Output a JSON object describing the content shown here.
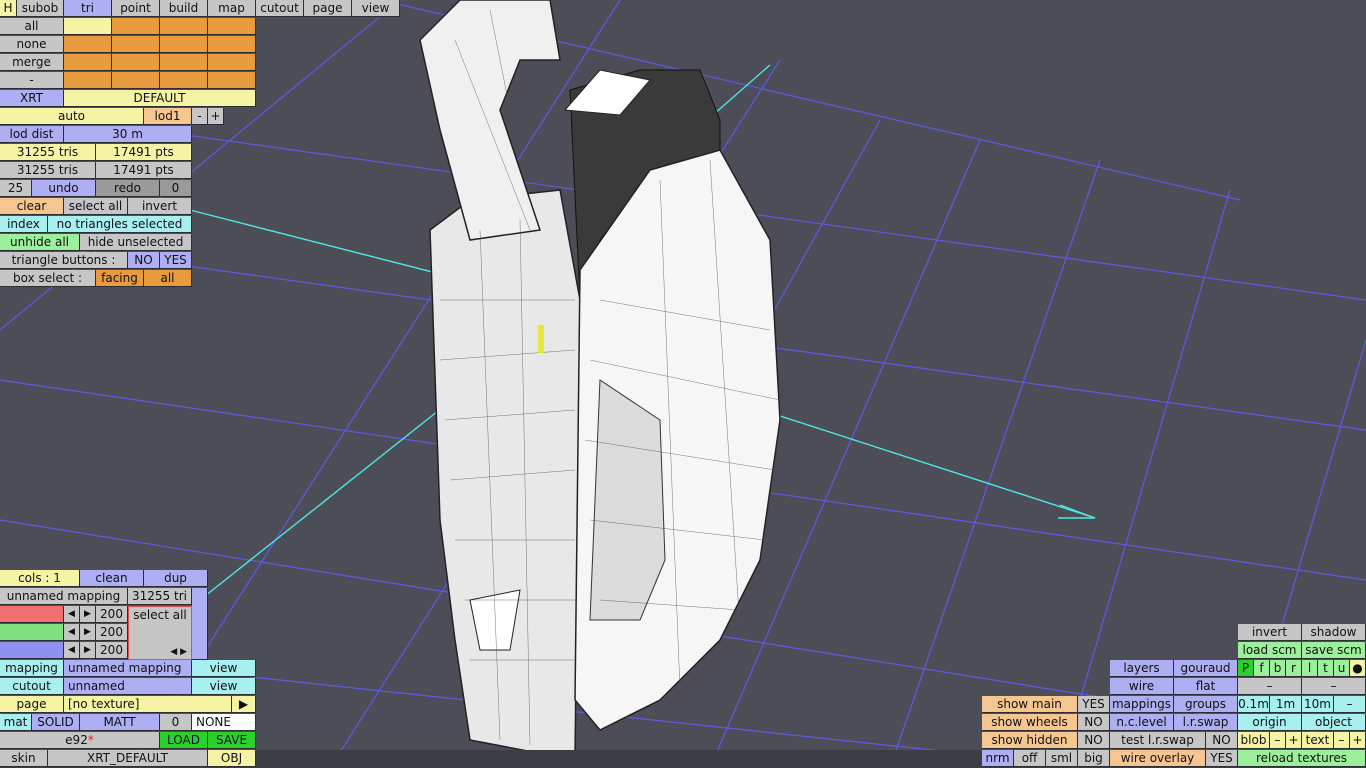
{
  "top_tabs": {
    "h": "H",
    "subob": "subob",
    "tri": "tri",
    "point": "point",
    "build": "build",
    "map": "map",
    "cutout": "cutout",
    "page": "page",
    "view": "view"
  },
  "left_panel": {
    "all": "all",
    "none": "none",
    "merge": "merge",
    "dash": "-",
    "xrt": "XRT",
    "default": "DEFAULT",
    "auto": "auto",
    "lod1": "lod1",
    "minus": "-",
    "plus": "+",
    "lod_dist_label": "lod dist",
    "lod_dist_value": "30 m",
    "tris1": "31255 tris",
    "pts1": "17491 pts",
    "tris2": "31255 tris",
    "pts2": "17491 pts",
    "undo_count": "25",
    "undo": "undo",
    "redo": "redo",
    "redo_count": "0",
    "clear": "clear",
    "select_all": "select all",
    "invert": "invert",
    "index": "index",
    "selection_status": "no triangles selected",
    "unhide_all": "unhide all",
    "hide_unselected": "hide unselected",
    "triangle_buttons": "triangle buttons :",
    "no": "NO",
    "yes": "YES",
    "box_select": "box select :",
    "facing": "facing",
    "box_all": "all"
  },
  "bottom_left": {
    "cols": "cols : 1",
    "clean": "clean",
    "dup": "dup",
    "mapping_name": "unnamed mapping",
    "tri_count": "31255 tri",
    "select_all": "select all",
    "slider_values": [
      "200",
      "200",
      "200"
    ],
    "slider_fill": [
      1.0,
      1.0,
      1.0,
      1.0
    ],
    "mapping_label": "mapping",
    "mapping_value": "unnamed mapping",
    "view1": "view",
    "cutout_label": "cutout",
    "cutout_value": "unnamed",
    "view2": "view",
    "page_label": "page",
    "page_value": "[no texture]",
    "play": "▶",
    "mat": "mat",
    "solid": "SOLID",
    "matt": "MATT",
    "zero": "0",
    "none": "NONE",
    "model_name": "e92",
    "modified_mark": "*",
    "load": "LOAD",
    "save": "SAVE",
    "skin": "skin",
    "skin_value": "XRT_DEFAULT",
    "obj": "OBJ"
  },
  "bottom_right": {
    "invert": "invert",
    "shadow": "shadow",
    "load_scm": "load scm",
    "save_scm": "save scm",
    "layers": "layers",
    "gouraud": "gouraud",
    "letters": [
      "P",
      "f",
      "b",
      "r",
      "l",
      "t",
      "u",
      "●"
    ],
    "wire": "wire",
    "flat": "flat",
    "dash1": "–",
    "dash2": "–",
    "show_main": "show main",
    "show_main_v": "YES",
    "mappings": "mappings",
    "groups": "groups",
    "s01": "0.1m",
    "s1": "1m",
    "s10": "10m",
    "sminus": "–",
    "show_wheels": "show wheels",
    "show_wheels_v": "NO",
    "nclevel": "n.c.level",
    "lrswap": "l.r.swap",
    "origin": "origin",
    "object": "object",
    "show_hidden": "show hidden",
    "show_hidden_v": "NO",
    "test_lrswap": "test l.r.swap",
    "test_v": "NO",
    "blob": "blob",
    "blob_minus": "–",
    "blob_plus": "+",
    "text": "text",
    "text_minus": "–",
    "text_plus": "+",
    "nrm": "nrm",
    "off": "off",
    "sml": "sml",
    "big": "big",
    "wire_overlay": "wire overlay",
    "wire_overlay_v": "YES",
    "reload_textures": "reload textures"
  }
}
